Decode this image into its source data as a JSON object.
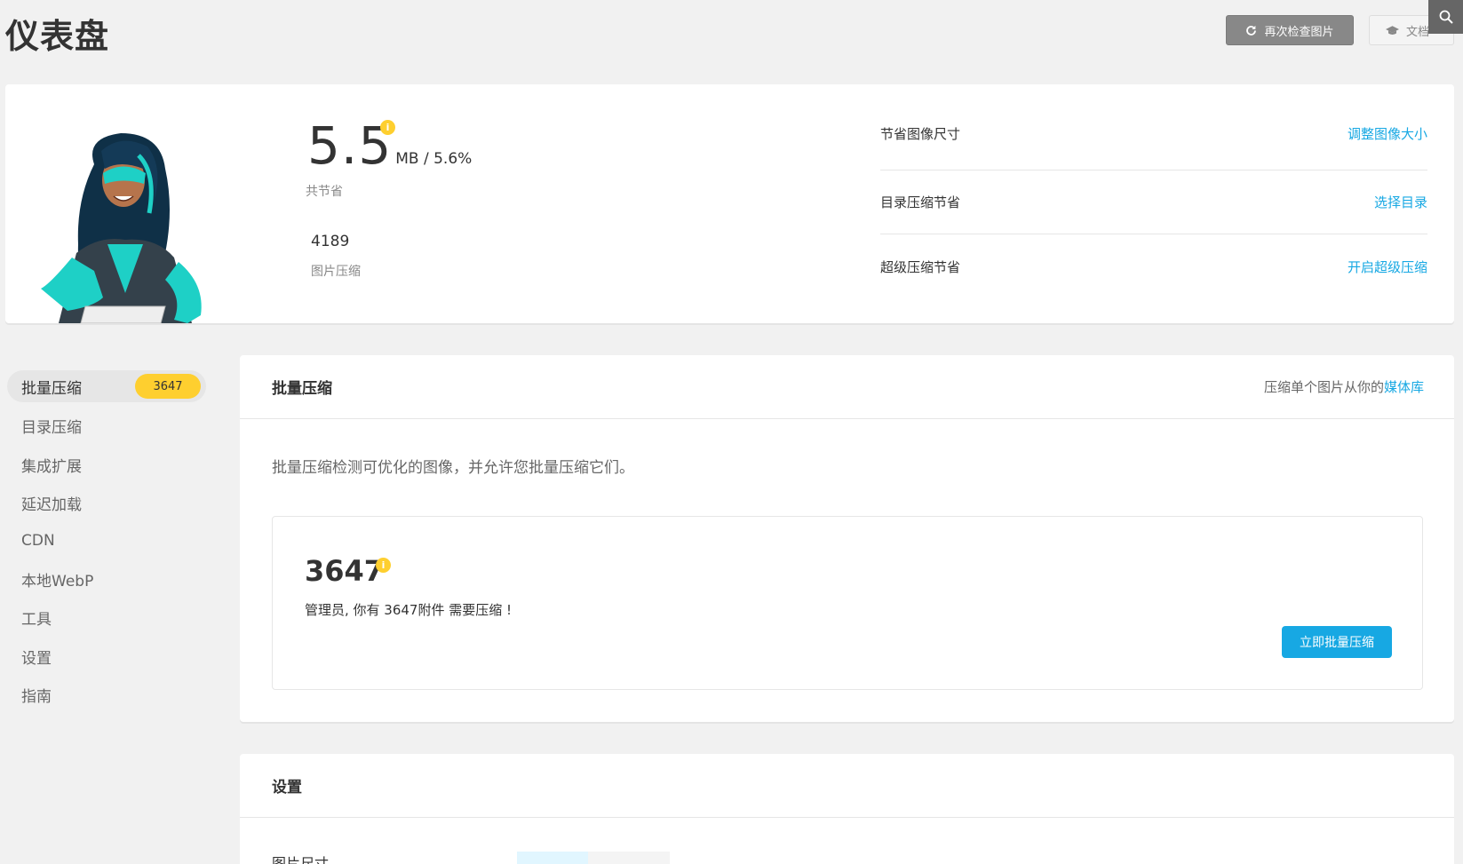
{
  "header": {
    "title": "仪表盘",
    "recheck_label": "再次检查图片",
    "docs_label": "文档",
    "recheck_icon": "refresh-icon",
    "docs_icon": "graduation-cap-icon",
    "search_icon": "search-icon"
  },
  "summary": {
    "total_saved": "5.5",
    "unit_percent": "MB / 5.6%",
    "total_saved_label": "共节省",
    "compressed_count": "4189",
    "compressed_label": "图片压缩",
    "info_glyph": "i",
    "rows": [
      {
        "label": "节省图像尺寸",
        "link": "调整图像大小"
      },
      {
        "label": "目录压缩节省",
        "link": "选择目录"
      },
      {
        "label": "超级压缩节省",
        "link": "开启超级压缩"
      }
    ]
  },
  "nav": {
    "items": [
      {
        "label": "批量压缩",
        "badge": "3647"
      },
      {
        "label": "目录压缩"
      },
      {
        "label": "集成扩展"
      },
      {
        "label": "延迟加载"
      },
      {
        "label": "CDN"
      },
      {
        "label": "本地WebP"
      },
      {
        "label": "工具"
      },
      {
        "label": "设置"
      },
      {
        "label": "指南"
      }
    ]
  },
  "bulk": {
    "title": "批量压缩",
    "header_right_text": "压缩单个图片从你的",
    "header_right_link": "媒体库",
    "description": "批量压缩检测可优化的图像，并允许您批量压缩它们。",
    "count": "3647",
    "message": "管理员, 你有 3647附件 需要压缩 !",
    "button_label": "立即批量压缩"
  },
  "settings": {
    "title": "设置",
    "first_label": "图片尺寸"
  },
  "colors": {
    "accent": "#17a8e3",
    "badge": "#fecf2f",
    "background": "#f1f1f1"
  }
}
